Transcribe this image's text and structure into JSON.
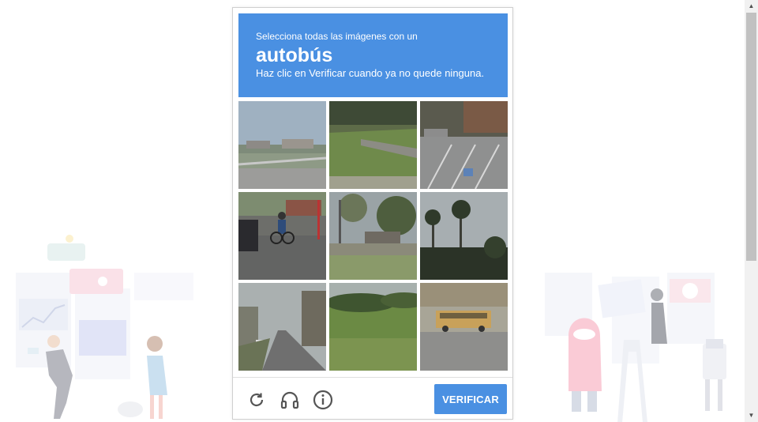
{
  "captcha": {
    "instruction_line1": "Selecciona todas las imágenes con un",
    "target_word": "autobús",
    "instruction_line3": "Haz clic en Verificar cuando ya no quede ninguna.",
    "tiles": [
      {
        "index": 1,
        "scene": "road-with-guardrail"
      },
      {
        "index": 2,
        "scene": "grass-slope-road"
      },
      {
        "index": 3,
        "scene": "parking-lot"
      },
      {
        "index": 4,
        "scene": "cyclist-intersection"
      },
      {
        "index": 5,
        "scene": "street-with-trees"
      },
      {
        "index": 6,
        "scene": "palm-trees"
      },
      {
        "index": 7,
        "scene": "tree-lined-road"
      },
      {
        "index": 8,
        "scene": "grass-field"
      },
      {
        "index": 9,
        "scene": "school-bus"
      }
    ],
    "footer": {
      "reload_icon": "reload-icon",
      "audio_icon": "headphones-icon",
      "info_icon": "info-icon",
      "verify_label": "VERIFICAR"
    },
    "colors": {
      "accent": "#4a90e2"
    }
  }
}
